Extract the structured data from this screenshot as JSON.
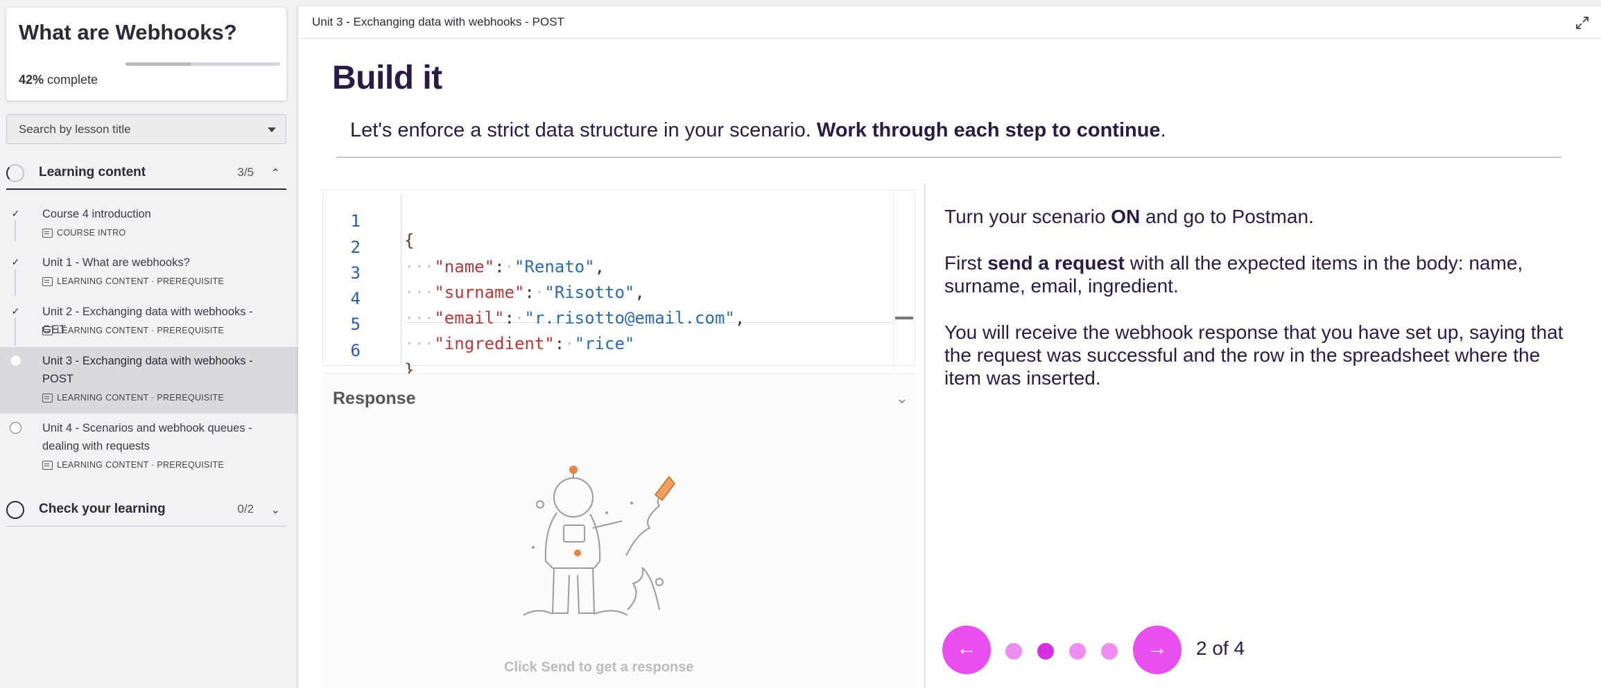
{
  "sidebar": {
    "course_title": "What are Webhooks?",
    "progress_percent": "42%",
    "progress_suffix": " complete",
    "progress_value": 0.42,
    "search_placeholder": "Search by lesson title",
    "sections": [
      {
        "title": "Learning content",
        "count": "3/5",
        "expanded": true
      },
      {
        "title": "Check your learning",
        "count": "0/2",
        "expanded": false
      }
    ],
    "lessons": [
      {
        "title": "Course 4 introduction",
        "meta": "COURSE INTRO",
        "status": "done"
      },
      {
        "title": "Unit 1 - What are webhooks?",
        "meta": "LEARNING CONTENT · PREREQUISITE",
        "status": "done"
      },
      {
        "title": "Unit 2 - Exchanging data with webhooks - GET",
        "meta": "LEARNING CONTENT · PREREQUISITE",
        "status": "done"
      },
      {
        "title": "Unit 3 - Exchanging data with webhooks - POST",
        "meta": "LEARNING CONTENT · PREREQUISITE",
        "status": "current"
      },
      {
        "title": "Unit 4 - Scenarios and webhook queues - dealing with requests",
        "meta": "LEARNING CONTENT · PREREQUISITE",
        "status": "todo"
      }
    ]
  },
  "main": {
    "topbar_title": "Unit 3 - Exchanging data with webhooks - POST",
    "heading": "Build it",
    "intro_plain": "Let's enforce a strict data structure in your scenario. ",
    "intro_bold": "Work through each step to continue",
    "intro_end": ".",
    "code_lines": [
      {
        "n": "1",
        "key": "",
        "value": "",
        "raw": "{"
      },
      {
        "n": "2",
        "key": "\"name\"",
        "value": "\"Renato\"",
        "comma": ","
      },
      {
        "n": "3",
        "key": "\"surname\"",
        "value": "\"Risotto\"",
        "comma": ","
      },
      {
        "n": "4",
        "key": "\"email\"",
        "value": "\"r.risotto@email.com\"",
        "comma": ","
      },
      {
        "n": "5",
        "key": "\"ingredient\"",
        "value": "\"rice\"",
        "comma": ""
      },
      {
        "n": "6",
        "key": "",
        "value": "",
        "raw": "}"
      }
    ],
    "response_title": "Response",
    "response_caption": "Click Send to get a response",
    "instructions": {
      "p1_a": "Turn your scenario ",
      "p1_b": "ON",
      "p1_c": " and go to Postman.",
      "p2_a": "First ",
      "p2_b": "send a request",
      "p2_c": " with all the expected items in the body: name, surname, email, ingredient.",
      "p3": "You will receive the webhook response that you have set up, saying that the request was successful and the row in the spreadsheet where the item was inserted."
    },
    "pager": {
      "prev_icon": "arrow-left-icon",
      "next_icon": "arrow-right-icon",
      "dots": 4,
      "active_index": 1,
      "label": "2 of 4"
    }
  },
  "colors": {
    "accent": "#e84ef0",
    "accent_active": "#d92fe4",
    "heading": "#2a1a46"
  }
}
